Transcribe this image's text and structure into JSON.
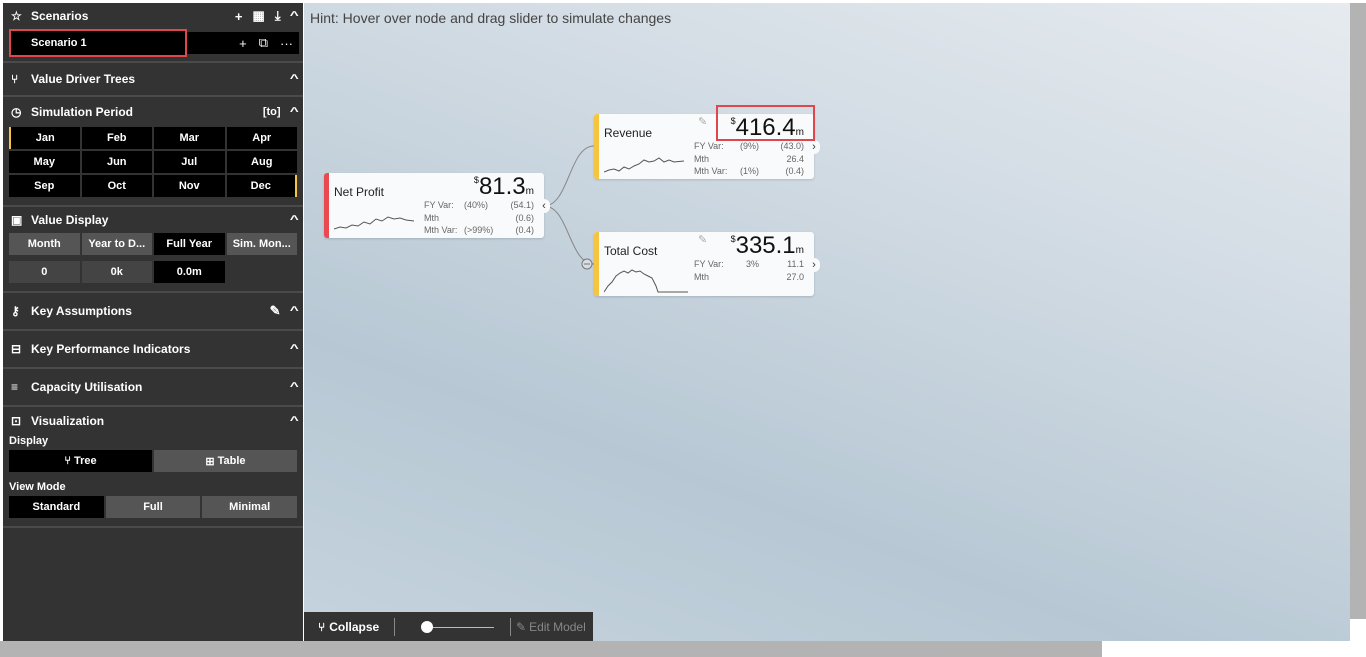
{
  "sidebar": {
    "scenarios": {
      "title": "Scenarios",
      "active": "Scenario 1"
    },
    "value_driver_trees": {
      "title": "Value Driver Trees"
    },
    "simulation_period": {
      "title": "Simulation Period",
      "mode": "[to]",
      "months": [
        "Jan",
        "Feb",
        "Mar",
        "Apr",
        "May",
        "Jun",
        "Jul",
        "Aug",
        "Sep",
        "Oct",
        "Nov",
        "Dec"
      ]
    },
    "value_display": {
      "title": "Value Display",
      "options": [
        "Month",
        "Year to D...",
        "Full Year",
        "Sim. Mon..."
      ],
      "selected": "Full Year",
      "formats": [
        "0",
        "0k",
        "0.0m"
      ],
      "selected_format": "0.0m"
    },
    "key_assumptions": {
      "title": "Key Assumptions"
    },
    "kpis": {
      "title": "Key Performance Indicators"
    },
    "capacity": {
      "title": "Capacity Utilisation"
    },
    "visualization": {
      "title": "Visualization",
      "display_label": "Display",
      "display_options": [
        "Tree",
        "Table"
      ],
      "display_selected": "Tree",
      "view_mode_label": "View Mode",
      "view_modes": [
        "Standard",
        "Full",
        "Minimal"
      ],
      "view_mode_selected": "Standard"
    }
  },
  "canvas": {
    "hint": "Hint: Hover over node and drag slider to simulate changes",
    "nodes": {
      "net_profit": {
        "name": "Net Profit",
        "currency": "$",
        "value": "81.3",
        "unit": "m",
        "color": "#e84a4f",
        "fy_var_label": "FY Var:",
        "fy_var_pct": "(40%)",
        "fy_var_val": "(54.1)",
        "mth_label": "Mth",
        "mth_val": "(0.6)",
        "mth_var_label": "Mth Var:",
        "mth_var_pct": "(>99%)",
        "mth_var_val": "(0.4)"
      },
      "revenue": {
        "name": "Revenue",
        "currency": "$",
        "value": "416.4",
        "unit": "m",
        "color": "#f5c542",
        "fy_var_label": "FY Var:",
        "fy_var_pct": "(9%)",
        "fy_var_val": "(43.0)",
        "mth_label": "Mth",
        "mth_val": "26.4",
        "mth_var_label": "Mth Var:",
        "mth_var_pct": "(1%)",
        "mth_var_val": "(0.4)"
      },
      "total_cost": {
        "name": "Total Cost",
        "currency": "$",
        "value": "335.1",
        "unit": "m",
        "color": "#f5c542",
        "fy_var_label": "FY Var:",
        "fy_var_pct": "3%",
        "fy_var_val": "11.1",
        "mth_label": "Mth",
        "mth_val": "27.0"
      }
    }
  },
  "toolbar": {
    "collapse": "Collapse",
    "edit_model": "Edit Model"
  }
}
